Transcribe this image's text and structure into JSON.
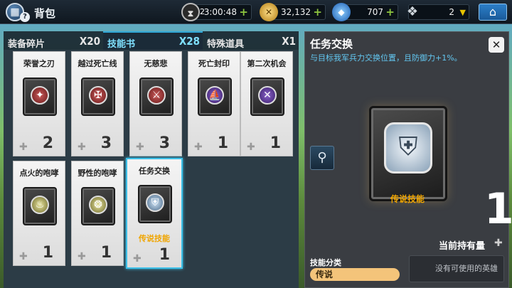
{
  "topbar": {
    "title": "背包",
    "bag_icon": "bag-icon",
    "help_badge": "?",
    "timer": {
      "icon": "hourglass-icon",
      "badge": "2",
      "value": "3:00:48"
    },
    "gold": {
      "icon": "gold-coin-icon",
      "value": "32,132"
    },
    "gems": {
      "icon": "blue-gem-icon",
      "value": "707"
    },
    "crystal": {
      "icon": "crystal-icon",
      "value": "2"
    },
    "home_icon": "home-icon"
  },
  "tabs": [
    {
      "label": "装备碎片",
      "count": "X20"
    },
    {
      "label": "技能书",
      "count": "X28"
    },
    {
      "label": "特殊道具",
      "count": "X1"
    }
  ],
  "cards": [
    {
      "name": "荣誉之刃",
      "qty": "2",
      "emblem": "sword-wings-icon",
      "tone": "red"
    },
    {
      "name": "越过死亡线",
      "qty": "3",
      "emblem": "skull-cross-icon",
      "tone": "red"
    },
    {
      "name": "无慈悲",
      "qty": "3",
      "emblem": "slash-icon",
      "tone": "red"
    },
    {
      "name": "死亡封印",
      "qty": "1",
      "emblem": "ship-seal-icon",
      "tone": "purple"
    },
    {
      "name": "第二次机会",
      "qty": "1",
      "emblem": "crossed-blades-icon",
      "tone": "purple"
    },
    {
      "name": "点火的咆哮",
      "qty": "1",
      "emblem": "flame-icon",
      "tone": "gold"
    },
    {
      "name": "野性的咆哮",
      "qty": "1",
      "emblem": "beast-icon",
      "tone": "gold"
    },
    {
      "name": "任务交换",
      "qty": "1",
      "emblem": "shield-swap-icon",
      "tone": "blue",
      "legend": "传说技能"
    }
  ],
  "detail": {
    "title": "任务交换",
    "description": "与目标我军兵力交换位置，且防御力+1%。",
    "legend_label": "传说技能",
    "owned_count": "1",
    "owned_label": "当前持有量",
    "category_label": "技能分类",
    "category_value": "传说",
    "no_hero_text": "没有可使用的英雄"
  }
}
